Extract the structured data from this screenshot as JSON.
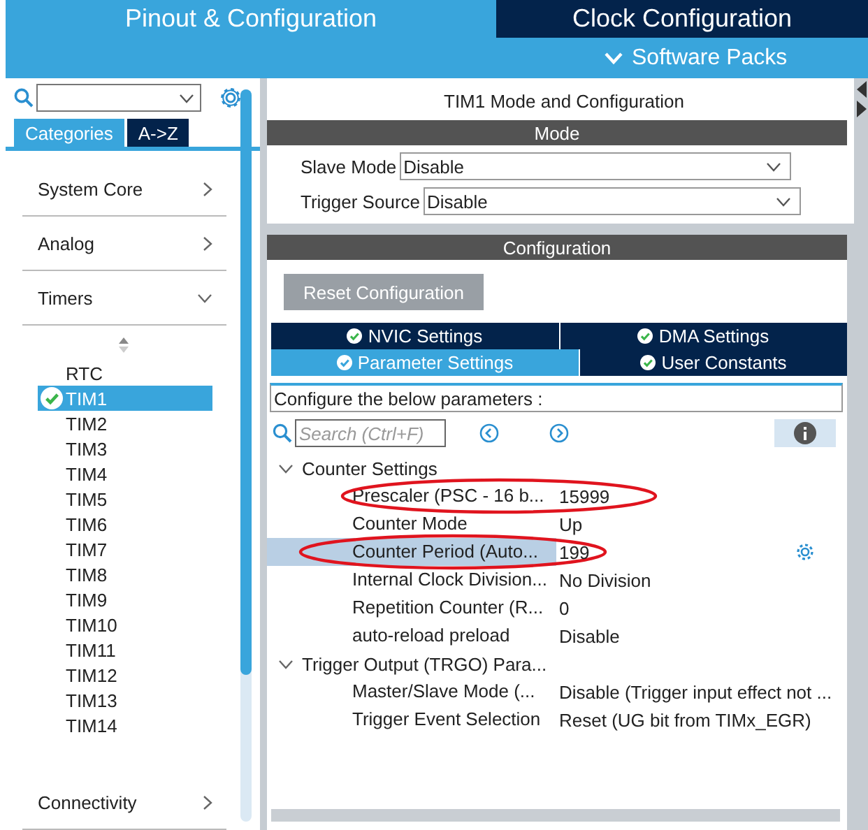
{
  "header": {
    "tabs": [
      {
        "label": "Pinout & Configuration",
        "selected": true
      },
      {
        "label": "Clock Configuration",
        "selected": false
      }
    ],
    "software_packs": "Software Packs"
  },
  "sidebar": {
    "tabs": [
      {
        "label": "Categories",
        "selected": true
      },
      {
        "label": "A->Z",
        "selected": false
      }
    ],
    "categories": [
      {
        "label": "System Core",
        "expanded": false
      },
      {
        "label": "Analog",
        "expanded": false
      },
      {
        "label": "Timers",
        "expanded": true,
        "children": [
          {
            "label": "RTC",
            "selected": false,
            "configured": false
          },
          {
            "label": "TIM1",
            "selected": true,
            "configured": true
          },
          {
            "label": "TIM2",
            "selected": false,
            "configured": false
          },
          {
            "label": "TIM3",
            "selected": false,
            "configured": false
          },
          {
            "label": "TIM4",
            "selected": false,
            "configured": false
          },
          {
            "label": "TIM5",
            "selected": false,
            "configured": false
          },
          {
            "label": "TIM6",
            "selected": false,
            "configured": false
          },
          {
            "label": "TIM7",
            "selected": false,
            "configured": false
          },
          {
            "label": "TIM8",
            "selected": false,
            "configured": false
          },
          {
            "label": "TIM9",
            "selected": false,
            "configured": false
          },
          {
            "label": "TIM10",
            "selected": false,
            "configured": false
          },
          {
            "label": "TIM11",
            "selected": false,
            "configured": false
          },
          {
            "label": "TIM12",
            "selected": false,
            "configured": false
          },
          {
            "label": "TIM13",
            "selected": false,
            "configured": false
          },
          {
            "label": "TIM14",
            "selected": false,
            "configured": false
          }
        ]
      },
      {
        "label": "Connectivity",
        "expanded": false
      }
    ]
  },
  "main": {
    "title": "TIM1 Mode and Configuration",
    "mode_header": "Mode",
    "mode_fields": [
      {
        "label": "Slave Mode",
        "value": "Disable"
      },
      {
        "label": "Trigger Source",
        "value": "Disable"
      }
    ],
    "config_header": "Configuration",
    "reset_button": "Reset Configuration",
    "settings_tabs": [
      [
        {
          "label": "NVIC Settings",
          "selected": false
        },
        {
          "label": "DMA Settings",
          "selected": false
        }
      ],
      [
        {
          "label": "Parameter Settings",
          "selected": true
        },
        {
          "label": "User Constants",
          "selected": false
        }
      ]
    ],
    "hint": "Configure the below parameters :",
    "search": {
      "placeholder": "Search (Ctrl+F)"
    },
    "parameters": [
      {
        "group": "Counter Settings",
        "expanded": true,
        "children": [
          {
            "label": "Prescaler (PSC - 16 b...",
            "value": "15999",
            "selected": false,
            "circled": true
          },
          {
            "label": "Counter Mode",
            "value": "Up",
            "selected": false,
            "circled": false
          },
          {
            "label": "Counter Period (Auto...",
            "value": "199",
            "selected": true,
            "circled": true
          },
          {
            "label": "Internal Clock Division...",
            "value": "No Division",
            "selected": false,
            "circled": false
          },
          {
            "label": "Repetition Counter (R...",
            "value": "0",
            "selected": false,
            "circled": false
          },
          {
            "label": "auto-reload preload",
            "value": "Disable",
            "selected": false,
            "circled": false
          }
        ]
      },
      {
        "group": "Trigger Output (TRGO) Para...",
        "expanded": true,
        "children": [
          {
            "label": "Master/Slave Mode (...",
            "value": "Disable (Trigger input effect not ...",
            "selected": false,
            "circled": false
          },
          {
            "label": "Trigger Event Selection",
            "value": "Reset (UG bit from TIMx_EGR)",
            "selected": false,
            "circled": false
          }
        ]
      }
    ]
  }
}
